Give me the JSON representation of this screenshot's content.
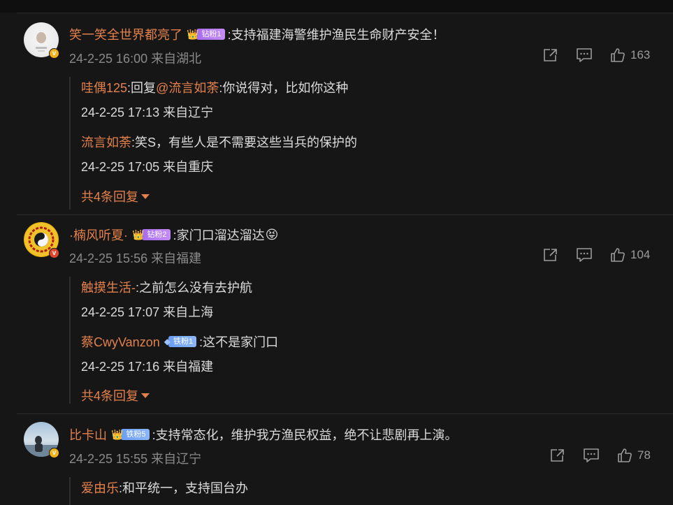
{
  "comments": [
    {
      "username": "笑一笑全世界都亮了",
      "fan_badge": "钻粉1",
      "text": ":支持福建海警维护渔民生命财产安全！",
      "time": "24-2-25 16:00",
      "location": "来自湖北",
      "likes": "163",
      "replies": [
        {
          "user": "哇偶125",
          "text_parts": [
            ":回复",
            "@流言如荼",
            ":你说得对，比如你这种"
          ],
          "time": "24-2-25 17:13 来自辽宁"
        },
        {
          "user": "流言如荼",
          "text": ":笑S，有些人是不需要这些当兵的保护的",
          "time": "24-2-25 17:05 来自重庆"
        }
      ],
      "more_replies": "共4条回复"
    },
    {
      "username": "·楠风听夏·",
      "fan_badge": "钻粉2",
      "text": ":家门口溜达溜达",
      "time": "24-2-25 15:56",
      "location": "来自福建",
      "likes": "104",
      "replies": [
        {
          "user": "触摸生活-",
          "text": ":之前怎么没有去护航",
          "time": "24-2-25 17:07 来自上海"
        },
        {
          "user": "蔡CwyVanzon",
          "fan_badge": "铁粉1",
          "text": ":这不是家门口",
          "time": "24-2-25 17:16 来自福建"
        }
      ],
      "more_replies": "共4条回复"
    },
    {
      "username": "比卡山",
      "fan_badge": "铁粉5",
      "text": ":支持常态化，维护我方渔民权益，绝不让悲剧再上演。",
      "time": "24-2-25 15:55",
      "location": "来自辽宁",
      "likes": "78",
      "replies": [
        {
          "user": "爱由乐",
          "text": ":和平统一，支持国台办"
        }
      ]
    }
  ],
  "icons": {
    "share": "share-icon",
    "comment": "comment-icon",
    "like": "thumbs-up-icon",
    "verified": "v",
    "dropdown": "triangle-down-icon"
  },
  "colors": {
    "background": "#161616",
    "username": "#e3814c",
    "meta": "#8a8a8a",
    "fan_purple": "#b57bf2",
    "fan_blue": "#7aa8f6"
  }
}
